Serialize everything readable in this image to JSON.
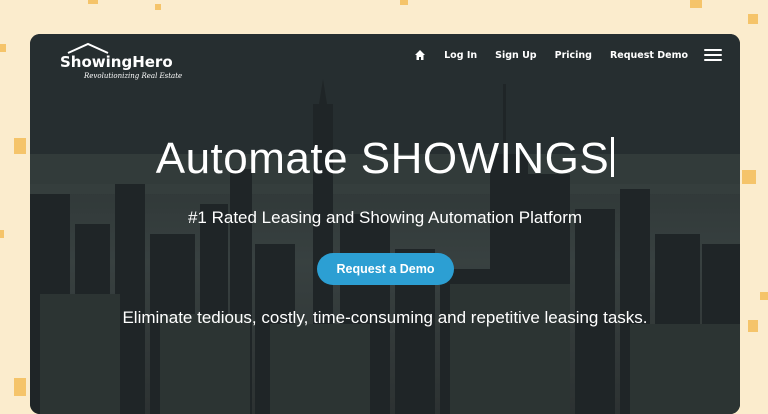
{
  "brand": {
    "name": "ShowingHero",
    "tagline": "Revolutionizing Real Estate"
  },
  "nav": {
    "items": [
      "Log In",
      "Sign Up",
      "Pricing",
      "Request Demo"
    ]
  },
  "hero": {
    "headline": "Automate SHOWINGS",
    "subheadline": "#1 Rated Leasing and Showing Automation Platform",
    "cta_label": "Request a Demo",
    "description": "Eliminate tedious, costly, time-consuming and repetitive leasing tasks."
  },
  "colors": {
    "background": "#fbeccd",
    "accent_squares": "#f5c46a",
    "cta": "#2c9fd3"
  },
  "icons": [
    "home-icon",
    "hamburger-menu-icon",
    "house-roof-logo-icon"
  ]
}
